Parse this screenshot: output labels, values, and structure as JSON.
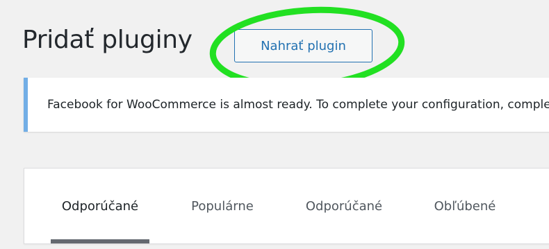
{
  "header": {
    "title": "Pridať pluginy",
    "upload_button_label": "Nahrať plugin"
  },
  "notice": {
    "text": "Facebook for WooCommerce is almost ready. To complete your configuration, complete the setup steps."
  },
  "filter_tabs": [
    {
      "label": "Odporúčané",
      "current": true
    },
    {
      "label": "Populárne",
      "current": false
    },
    {
      "label": "Odporúčané",
      "current": false
    },
    {
      "label": "Obľúbené",
      "current": false
    }
  ],
  "colors": {
    "accent": "#2271b1",
    "notice_border": "#72aee6",
    "highlight_ring": "#22e022",
    "background": "#f1f1f1"
  }
}
